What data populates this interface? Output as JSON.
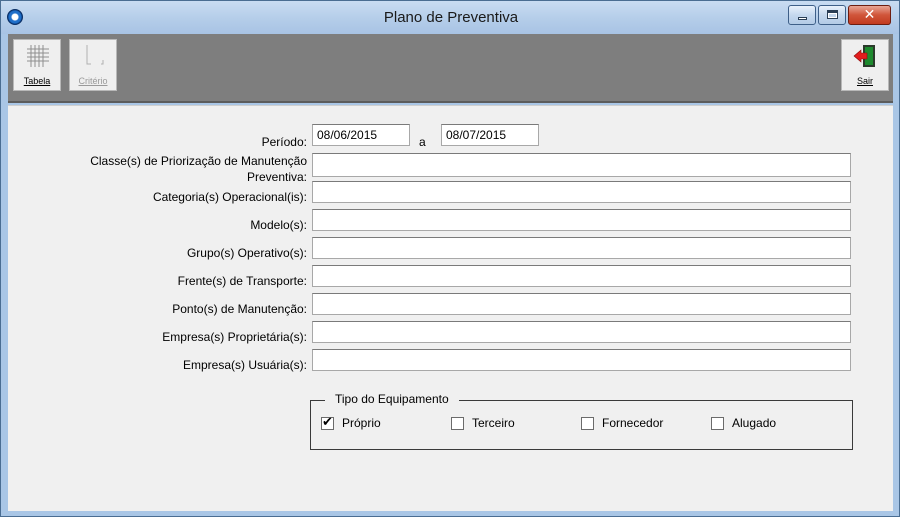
{
  "window": {
    "title": "Plano de Preventiva"
  },
  "toolbar": {
    "tabela_label": "Tabela",
    "criterio_label": "Critério",
    "sair_label": "Sair"
  },
  "form": {
    "periodo_label": "Período:",
    "periodo_inicio": "08/06/2015",
    "periodo_sep": "a",
    "periodo_fim": "08/07/2015",
    "classe_label_line1": "Classe(s) de Priorização de Manutenção",
    "classe_label_line2": "Preventiva:",
    "categoria_label": "Categoria(s) Operacional(is):",
    "modelo_label": "Modelo(s):",
    "grupo_label": "Grupo(s) Operativo(s):",
    "frente_label": "Frente(s) de Transporte:",
    "ponto_label": "Ponto(s) de Manutenção:",
    "empresa_prop_label": "Empresa(s) Proprietária(s):",
    "empresa_usu_label": "Empresa(s) Usuária(s):",
    "classe_value": "",
    "categoria_value": "",
    "modelo_value": "",
    "grupo_value": "",
    "frente_value": "",
    "ponto_value": "",
    "empresa_prop_value": "",
    "empresa_usu_value": ""
  },
  "tipo_equipamento": {
    "legend": "Tipo do Equipamento",
    "options": [
      {
        "label": "Próprio",
        "checked": true,
        "mark": "✔"
      },
      {
        "label": "Terceiro",
        "checked": false,
        "mark": ""
      },
      {
        "label": "Fornecedor",
        "checked": false,
        "mark": ""
      },
      {
        "label": "Alugado",
        "checked": false,
        "mark": ""
      }
    ]
  }
}
